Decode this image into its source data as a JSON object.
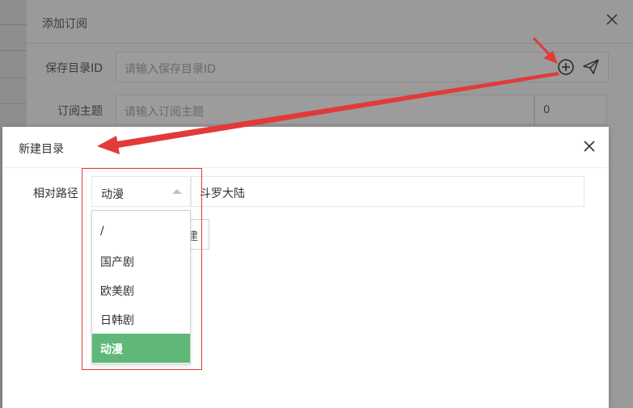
{
  "background": {
    "top_fragment": "...... ..."
  },
  "outer_dialog": {
    "title": "添加订阅",
    "fields": [
      {
        "label": "保存目录ID",
        "placeholder": "请输入保存目录ID"
      },
      {
        "label": "订阅主题",
        "placeholder": "请输入订阅主题"
      }
    ],
    "counter_value": "0",
    "icons": {
      "add": "plus-circle-icon",
      "send": "send-icon",
      "close": "close-icon"
    }
  },
  "inner_dialog": {
    "title": "新建目录",
    "path_label": "相对路径",
    "select": {
      "selected": "动漫",
      "options": [
        "/",
        "国产剧",
        "欧美剧",
        "日韩剧",
        "动漫"
      ],
      "selected_index": 4
    },
    "name_input_value": "斗罗大陆",
    "partial_button_text": "建",
    "icons": {
      "close": "close-icon",
      "caret": "caret-up-icon"
    }
  },
  "colors": {
    "selected_option_bg": "#5fb878",
    "annotation_red": "#e23a3a"
  }
}
